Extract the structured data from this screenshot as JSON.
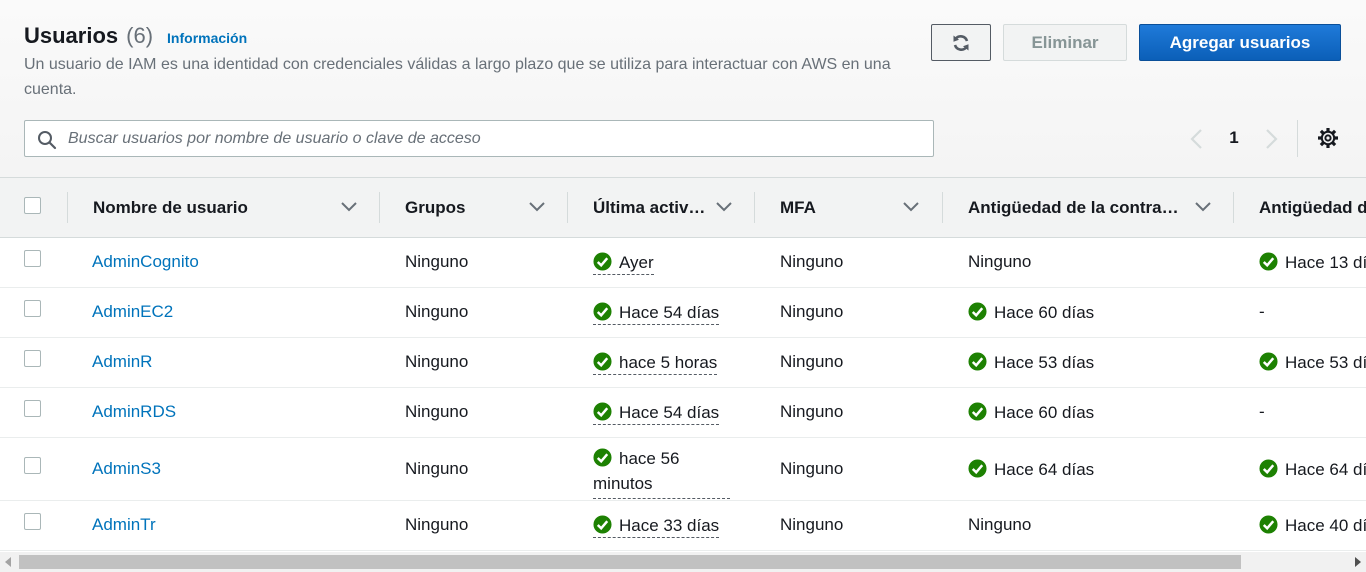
{
  "header": {
    "title": "Usuarios",
    "count": "(6)",
    "info_link": "Información",
    "description": "Un usuario de IAM es una identidad con credenciales válidas a largo plazo que se utiliza para interactuar con AWS en una cuenta."
  },
  "toolbar": {
    "refresh_icon": "refresh-icon",
    "delete_label": "Eliminar",
    "add_label": "Agregar usuarios"
  },
  "search": {
    "placeholder": "Buscar usuarios por nombre de usuario o clave de acceso",
    "value": ""
  },
  "pagination": {
    "current_page": "1"
  },
  "table": {
    "columns": [
      "Nombre de usuario",
      "Grupos",
      "Última activ…",
      "MFA",
      "Antigüedad de la contra…",
      "Antigüedad d"
    ],
    "rows": [
      {
        "name": "AdminCognito",
        "groups": "Ninguno",
        "last_activity": "Ayer",
        "mfa": "Ninguno",
        "password_age": "Ninguno",
        "password_age_ok": false,
        "key_age": "Hace 13 dí",
        "key_age_ok": true
      },
      {
        "name": "AdminEC2",
        "groups": "Ninguno",
        "last_activity": "Hace 54 días",
        "mfa": "Ninguno",
        "password_age": "Hace 60 días",
        "password_age_ok": true,
        "key_age": "-",
        "key_age_ok": false
      },
      {
        "name": "AdminR",
        "groups": "Ninguno",
        "last_activity": "hace 5 horas",
        "mfa": "Ninguno",
        "password_age": "Hace 53 días",
        "password_age_ok": true,
        "key_age": "Hace 53 dí",
        "key_age_ok": true
      },
      {
        "name": "AdminRDS",
        "groups": "Ninguno",
        "last_activity": "Hace 54 días",
        "mfa": "Ninguno",
        "password_age": "Hace 60 días",
        "password_age_ok": true,
        "key_age": "-",
        "key_age_ok": false
      },
      {
        "name": "AdminS3",
        "groups": "Ninguno",
        "last_activity": "hace 56 minutos",
        "mfa": "Ninguno",
        "password_age": "Hace 64 días",
        "password_age_ok": true,
        "key_age": "Hace 64 dí",
        "key_age_ok": true
      },
      {
        "name": "AdminTr",
        "groups": "Ninguno",
        "last_activity": "Hace 33 días",
        "mfa": "Ninguno",
        "password_age": "Ninguno",
        "password_age_ok": false,
        "key_age": "Hace 40 dí",
        "key_age_ok": true
      }
    ]
  },
  "colors": {
    "link": "#0073bb",
    "primary_button": "#0b5fb8",
    "success": "#1d8102",
    "header_bg": "#f2f3f3"
  }
}
